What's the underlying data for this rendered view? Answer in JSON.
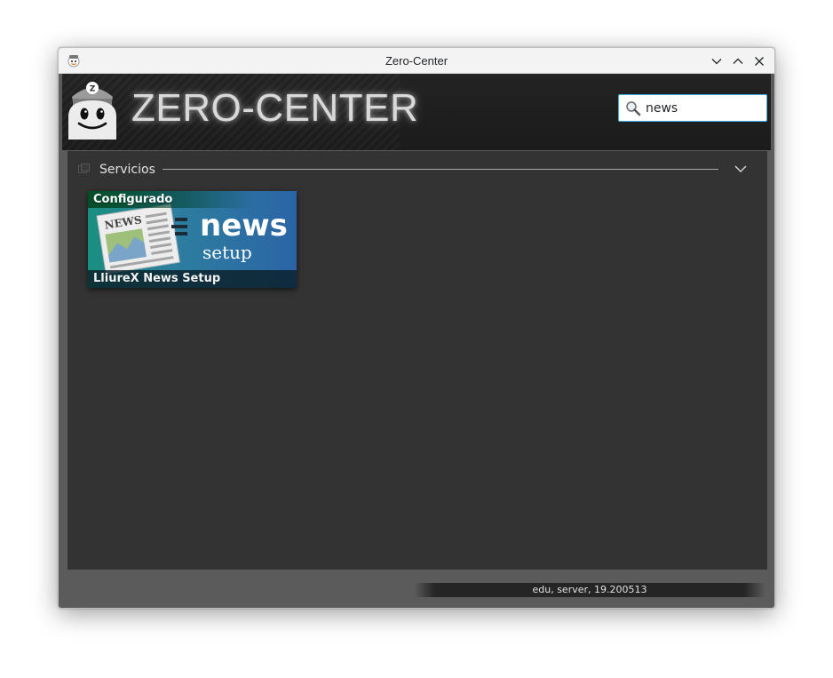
{
  "window": {
    "title": "Zero-Center"
  },
  "header": {
    "logo_text": "ZERO-CENTER",
    "mascot_badge": "Z"
  },
  "search": {
    "value": "news"
  },
  "section": {
    "title": "Servicios"
  },
  "tiles": [
    {
      "status": "Configurado",
      "art_title": "news",
      "art_subtitle": "setup",
      "art_paper_label": "NEWS",
      "name": "LliureX News Setup"
    }
  ],
  "footer": {
    "version_text": "edu, server, 19.200513"
  },
  "colors": {
    "accent": "#3daee9",
    "panel_bg": "#333333",
    "header_bg": "#1e1e1e"
  }
}
